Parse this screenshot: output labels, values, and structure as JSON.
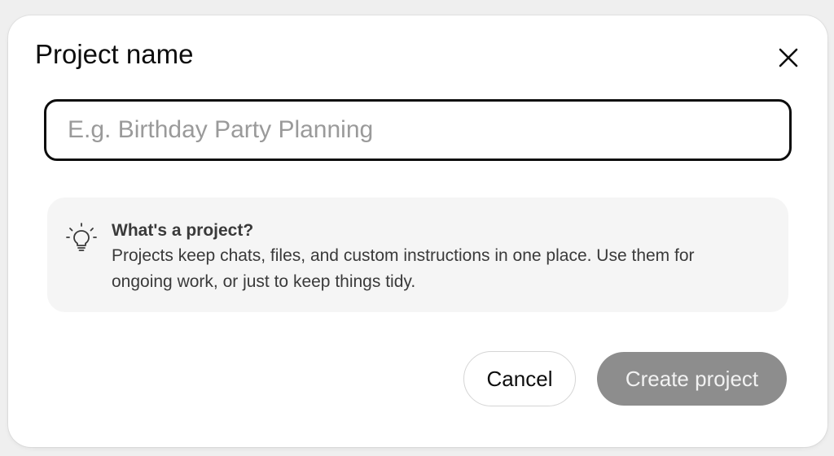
{
  "dialog": {
    "title": "Project name",
    "close_icon": "close-icon"
  },
  "name_input": {
    "value": "",
    "placeholder": "E.g. Birthday Party Planning"
  },
  "info": {
    "icon": "lightbulb-icon",
    "title": "What's a project?",
    "text": "Projects keep chats, files, and custom instructions in one place. Use them for ongoing work, or just to keep things tidy."
  },
  "actions": {
    "cancel_label": "Cancel",
    "create_label": "Create project",
    "create_enabled": false
  },
  "colors": {
    "text": "#0d0d0d",
    "placeholder": "#9a9a9a",
    "info_bg": "#f5f5f5",
    "create_button_disabled": "#8d8d8d"
  }
}
